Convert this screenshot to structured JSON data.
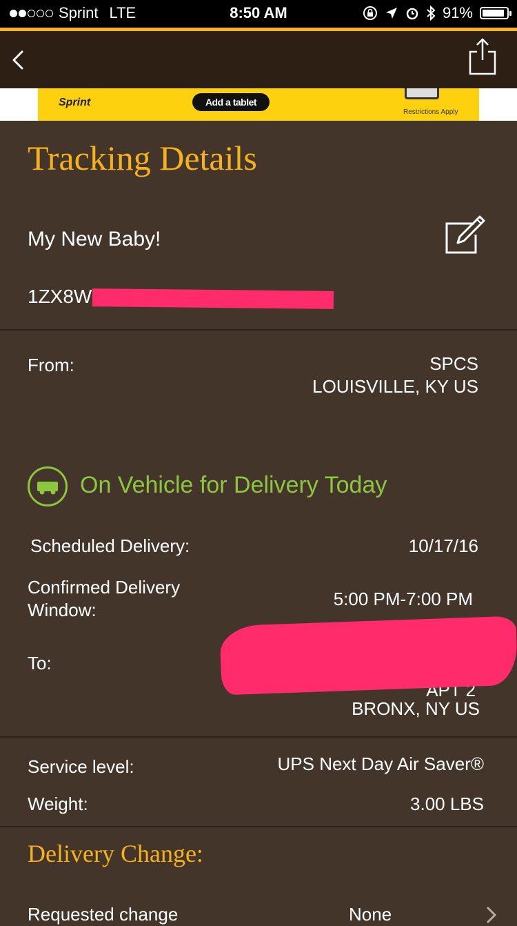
{
  "status_bar": {
    "carrier": "Sprint",
    "network": "LTE",
    "time": "8:50 AM",
    "battery_percent": "91%",
    "battery_level": 0.91,
    "signal_bars_filled": 2,
    "signal_bars_total": 5
  },
  "nav": {
    "back_icon": "chevron-left-icon",
    "share_icon": "share-icon"
  },
  "ad": {
    "brand": "Sprint",
    "cta": "Add a tablet",
    "fine_print": "Restrictions Apply"
  },
  "page": {
    "title": "Tracking Details"
  },
  "shipment": {
    "name": "My New Baby!",
    "tracking_number_visible": "1ZX8W",
    "edit_icon": "edit-icon"
  },
  "origin": {
    "label": "From:",
    "name": "SPCS",
    "location": "LOUISVILLE, KY US"
  },
  "status": {
    "icon": "truck-icon",
    "text": "On Vehicle for Delivery Today"
  },
  "delivery": {
    "scheduled_label": "Scheduled Delivery:",
    "scheduled_value": "10/17/16",
    "window_label_line1": "Confirmed Delivery",
    "window_label_line2": "Window:",
    "window_value": "5:00 PM-7:00 PM",
    "to_label": "To:",
    "to_partial": "APT 2",
    "to_city": "BRONX, NY US"
  },
  "details": {
    "service_label": "Service level:",
    "service_value": "UPS Next Day Air Saver®",
    "weight_label": "Weight:",
    "weight_value": "3.00 LBS"
  },
  "delivery_change": {
    "title": "Delivery Change:",
    "requested_label": "Requested change",
    "requested_value": "None"
  },
  "colors": {
    "background": "#43352a",
    "nav": "#2e1f15",
    "accent_gold": "#f7b21b",
    "status_green": "#8dc63f",
    "redaction": "#ff2b6b"
  }
}
